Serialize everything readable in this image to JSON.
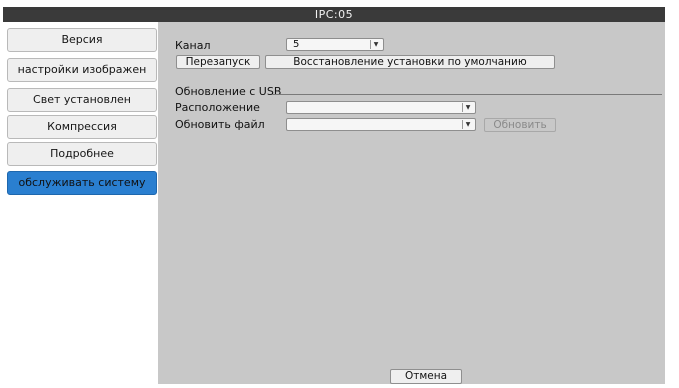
{
  "window": {
    "title": "IPC:05"
  },
  "sidebar": {
    "items": [
      {
        "label": "Версия",
        "active": false
      },
      {
        "label": "настройки изображен",
        "active": false
      },
      {
        "label": "Свет установлен",
        "active": false
      },
      {
        "label": "Компрессия",
        "active": false
      },
      {
        "label": "Подробнее",
        "active": false
      },
      {
        "label": "обслуживать систему",
        "active": true
      }
    ]
  },
  "maintenance": {
    "channel_label": "Канал",
    "channel_value": "5",
    "restart_label": "Перезапуск",
    "restore_defaults_label": "Восстановление установки по умолчанию",
    "usb_update": {
      "section_title": "Обновление с USB",
      "location_label": "Расположение",
      "location_value": "",
      "update_file_label": "Обновить файл",
      "update_file_value": "",
      "update_button_label": "Обновить"
    },
    "cancel_label": "Отмена"
  },
  "icons": {
    "dropdown_arrow": "chevron-down-icon"
  },
  "colors": {
    "title_bar": "#3a3a3a",
    "panel_background": "#c8c8c8",
    "active_nav": "#2a7fd0"
  }
}
